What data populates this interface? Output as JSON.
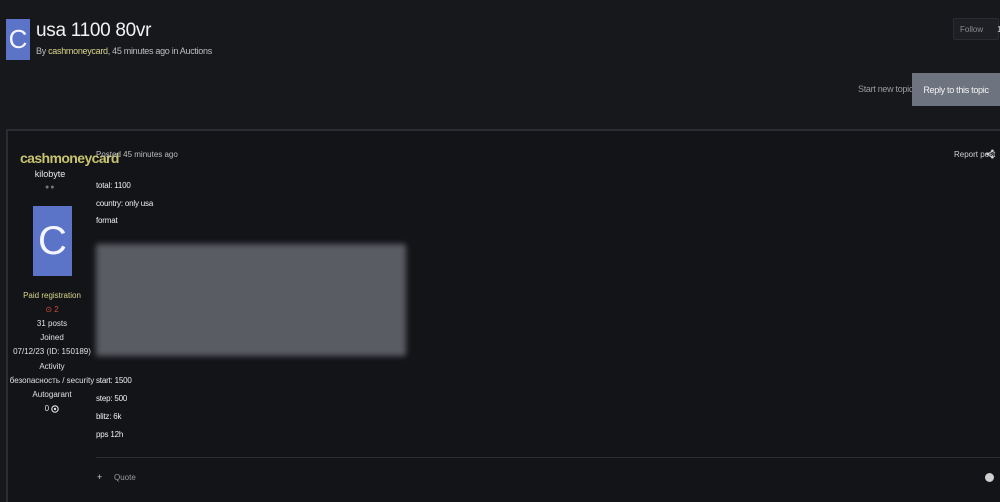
{
  "topic": {
    "avatar_letter": "C",
    "title": "usa 1100 80vr",
    "by_prefix": "By ",
    "author": "cashmoneycard",
    "by_suffix": ", 45 minutes ago in Auctions"
  },
  "actions": {
    "follow_label": "Follow",
    "follow_count": "1",
    "start_new_topic": "Start new topic",
    "reply": "Reply to this topic"
  },
  "author": {
    "name": "cashmoneycard",
    "rank": "kilobyte",
    "rank_dots": "●●",
    "avatar_letter": "C",
    "group": "Paid registration",
    "reputation": "⊙ 2",
    "posts": "31 posts",
    "joined_label": "Joined",
    "joined_value": "07/12/23 (ID: 150189)",
    "activity_label": "Activity",
    "activity_value": "безопасность / security",
    "autogarant_label": "Autogarant",
    "autogarant_value": "0"
  },
  "post": {
    "posted": "Posted 45 minutes ago",
    "report": "Report post",
    "lines_top": [
      "total: 1100",
      "country: only usa",
      "format"
    ],
    "lines_bottom": [
      "start: 1500",
      "step: 500",
      "blitz: 6k",
      "pps 12h"
    ],
    "quote": "Quote",
    "quote_icon": "+"
  },
  "colors": {
    "background": "#17181c",
    "avatar": "#5b74c8",
    "author_name": "#c8c36e",
    "reply_button": "#6d7480"
  }
}
